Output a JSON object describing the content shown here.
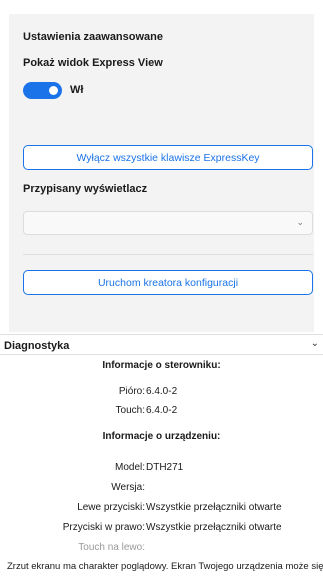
{
  "settings": {
    "advanced_heading": "Ustawienia zaawansowane",
    "express_view_heading": "Pokaż widok Express View",
    "toggle_state": "Wł",
    "disable_expresskeys_button": "Wyłącz wszystkie klawisze ExpressKey",
    "assigned_display_heading": "Przypisany wyświetlacz",
    "display_select_value": "",
    "setup_wizard_button": "Uruchom kreatora konfiguracji"
  },
  "diagnostics": {
    "heading": "Diagnostyka",
    "driver_info_title": "Informacje o sterowniku:",
    "driver_rows": [
      {
        "label": "Pióro:",
        "value": "6.4.0-2"
      },
      {
        "label": "Touch:",
        "value": "6.4.0-2"
      }
    ],
    "device_info_title": "Informacje o urządzeniu:",
    "device_rows": [
      {
        "label": "Model:",
        "value": "DTH271"
      },
      {
        "label": "Wersja:",
        "value": ""
      },
      {
        "label": "Lewe przyciski:",
        "value": "Wszystkie przełączniki otwarte"
      },
      {
        "label": "Przyciski w prawo:",
        "value": "Wszystkie przełączniki otwarte"
      },
      {
        "label": "Touch na lewo:",
        "value": ""
      }
    ]
  },
  "footer": {
    "disclaimer": "Zrzut ekranu ma charakter poglądowy. Ekran Twojego urządzenia może się różnić."
  },
  "colors": {
    "accent": "#1a73e8",
    "card_bg": "#f3f3f3"
  }
}
